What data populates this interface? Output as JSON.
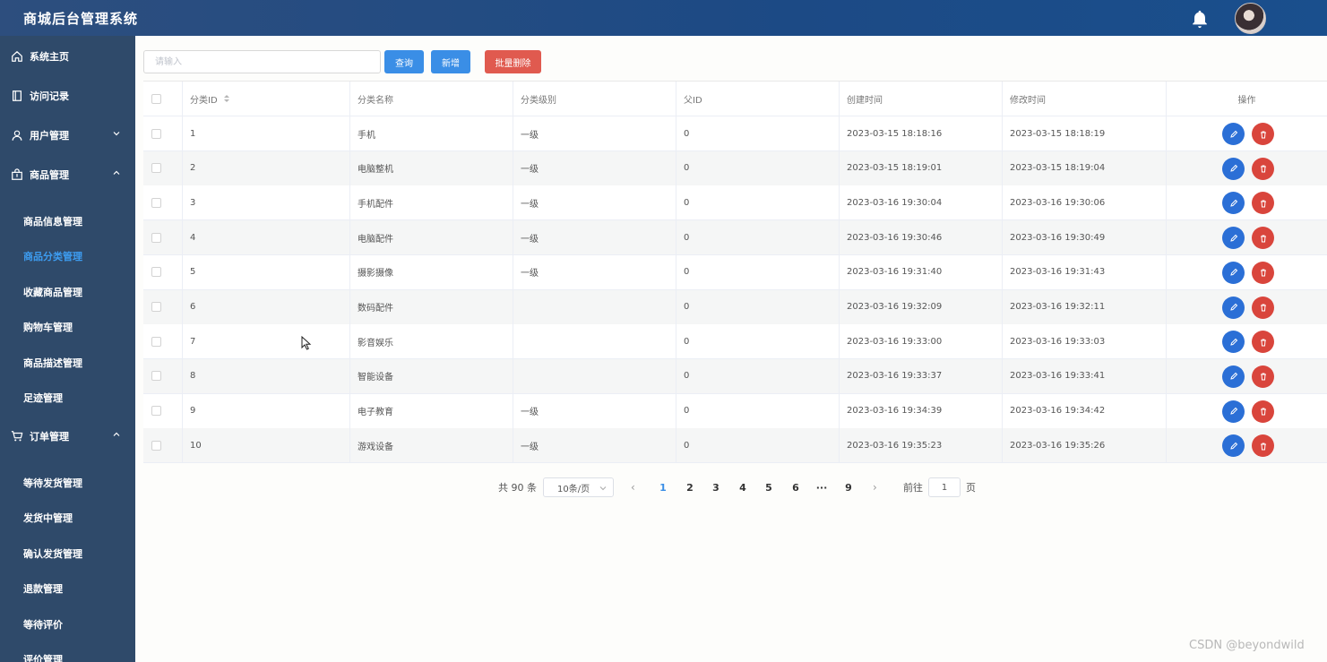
{
  "header": {
    "title": "商城后台管理系统"
  },
  "sidebar": {
    "home": "系统主页",
    "visits": "访问记录",
    "users": "用户管理",
    "products": "商品管理",
    "product_items": [
      "商品信息管理",
      "商品分类管理",
      "收藏商品管理",
      "购物车管理",
      "商品描述管理",
      "足迹管理"
    ],
    "orders": "订单管理",
    "order_items": [
      "等待发货管理",
      "发货中管理",
      "确认发货管理",
      "退款管理",
      "等待评价",
      "评价管理"
    ]
  },
  "toolbar": {
    "search_placeholder": "请输入",
    "query_label": "查询",
    "add_label": "新增",
    "batch_delete_label": "批量删除"
  },
  "table": {
    "headers": [
      "分类ID",
      "分类名称",
      "分类级别",
      "父ID",
      "创建时间",
      "修改时间",
      "操作"
    ],
    "rows": [
      [
        "1",
        "手机",
        "一级",
        "0",
        "2023-03-15 18:18:16",
        "2023-03-15 18:18:19"
      ],
      [
        "2",
        "电脑整机",
        "一级",
        "0",
        "2023-03-15 18:19:01",
        "2023-03-15 18:19:04"
      ],
      [
        "3",
        "手机配件",
        "一级",
        "0",
        "2023-03-16 19:30:04",
        "2023-03-16 19:30:06"
      ],
      [
        "4",
        "电脑配件",
        "一级",
        "0",
        "2023-03-16 19:30:46",
        "2023-03-16 19:30:49"
      ],
      [
        "5",
        "摄影摄像",
        "一级",
        "0",
        "2023-03-16 19:31:40",
        "2023-03-16 19:31:43"
      ],
      [
        "6",
        "数码配件",
        "",
        "0",
        "2023-03-16 19:32:09",
        "2023-03-16 19:32:11"
      ],
      [
        "7",
        "影音娱乐",
        "",
        "0",
        "2023-03-16 19:33:00",
        "2023-03-16 19:33:03"
      ],
      [
        "8",
        "智能设备",
        "",
        "0",
        "2023-03-16 19:33:37",
        "2023-03-16 19:33:41"
      ],
      [
        "9",
        "电子教育",
        "一级",
        "0",
        "2023-03-16 19:34:39",
        "2023-03-16 19:34:42"
      ],
      [
        "10",
        "游戏设备",
        "一级",
        "0",
        "2023-03-16 19:35:23",
        "2023-03-16 19:35:26"
      ]
    ]
  },
  "pagination": {
    "total": "共 90 条",
    "page_size": "10条/页",
    "pages": [
      "1",
      "2",
      "3",
      "4",
      "5",
      "6",
      "···",
      "9"
    ],
    "current": "1",
    "goto_prefix": "前往",
    "goto_value": "1",
    "goto_suffix": "页"
  },
  "watermark": "CSDN @beyondwild",
  "colors": {
    "header": "#1c4a85",
    "sidebar": "#2f4a6a",
    "primary": "#3a8ee6",
    "danger": "#e05a4f",
    "active_menu": "#3d9cf0"
  }
}
